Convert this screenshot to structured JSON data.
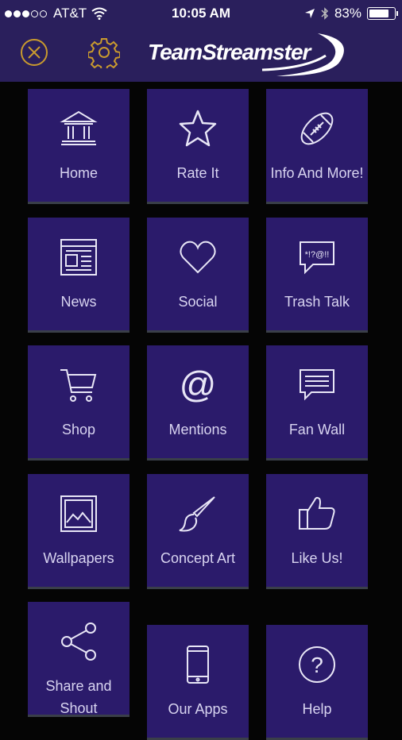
{
  "status_bar": {
    "carrier": "AT&T",
    "time": "10:05 AM",
    "battery": "83%"
  },
  "header": {
    "logo_text": "TeamStreamster"
  },
  "tiles": [
    {
      "label": "Home",
      "icon": "home-icon"
    },
    {
      "label": "Rate It",
      "icon": "star-icon"
    },
    {
      "label": "Info And More!",
      "icon": "football-icon"
    },
    {
      "label": "News",
      "icon": "newspaper-icon"
    },
    {
      "label": "Social",
      "icon": "heart-icon"
    },
    {
      "label": "Trash Talk",
      "icon": "speech-bubble-icon",
      "bubble_text": "*!?@!!"
    },
    {
      "label": "Shop",
      "icon": "cart-icon"
    },
    {
      "label": "Mentions",
      "icon": "at-icon",
      "icon_text": "@"
    },
    {
      "label": "Fan Wall",
      "icon": "message-icon"
    },
    {
      "label": "Wallpapers",
      "icon": "picture-icon"
    },
    {
      "label": "Concept Art",
      "icon": "brush-icon"
    },
    {
      "label": "Like Us!",
      "icon": "thumbs-up-icon"
    },
    {
      "label": "Share and Shout",
      "label_line1": "Share and",
      "label_line2": "Shout",
      "icon": "share-icon"
    },
    {
      "label": "Our Apps",
      "icon": "phone-icon"
    },
    {
      "label": "Help",
      "icon": "help-icon",
      "icon_text": "?"
    }
  ],
  "colors": {
    "header_bg": "#2a1f5c",
    "tile_bg": "#2b1b6b",
    "page_bg": "#050505",
    "accent_gold": "#c99a2e"
  }
}
